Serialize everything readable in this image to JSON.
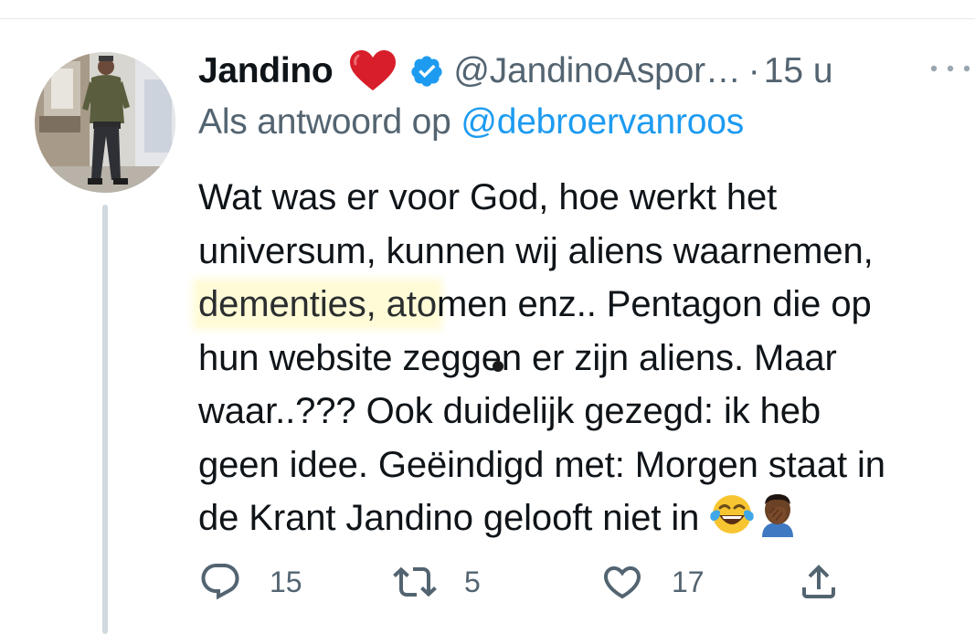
{
  "tweet": {
    "author_name": "Jandino",
    "author_handle": "@JandinoAspor…",
    "separator": "·",
    "time": "15 u",
    "reply_prefix": "Als antwoord op",
    "reply_mention": "@debroervanroos",
    "text_lines": [
      "Wat was er voor God, hoe werkt het",
      "universum, kunnen wij aliens waarnemen,",
      [
        "dementies, ato",
        "men enz.. Pentagon die op"
      ],
      "hun website zeggen er zijn aliens. Maar",
      "waar..??? Ook duidelijk gezegd: ik heb",
      "geen idee. Geëindigd met: Morgen staat in",
      "de Krant Jandino gelooft niet in"
    ],
    "emojis": [
      "tears-of-joy-emoji",
      "facepalm-emoji"
    ],
    "badges": [
      "red-heart-icon",
      "verified-badge-icon"
    ]
  },
  "actions": {
    "reply_count": "15",
    "retweet_count": "5",
    "like_count": "17"
  },
  "colors": {
    "text": "#0f1419",
    "secondary": "#536471",
    "link": "#1d9bf0",
    "thread_line": "#cfd9de",
    "highlight": "#fff596"
  }
}
